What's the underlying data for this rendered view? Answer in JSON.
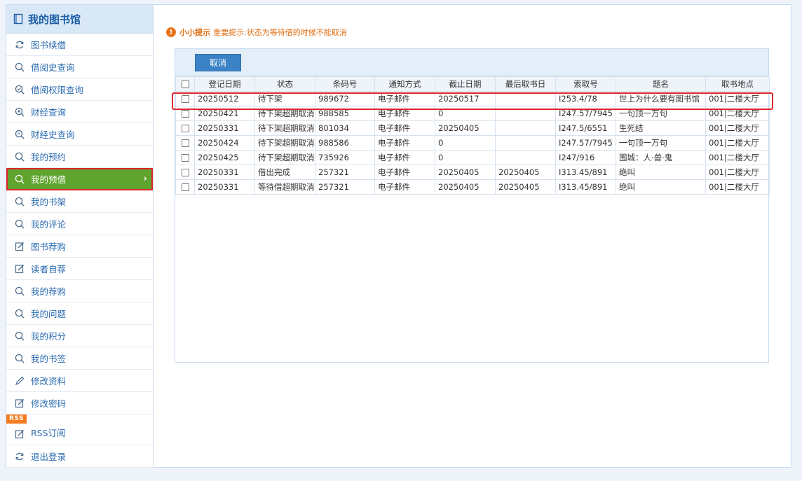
{
  "sidebar": {
    "title": "我的图书馆",
    "items": [
      {
        "label": "图书续借",
        "icon": "refresh-icon",
        "name": "sidebar-item-book-renew"
      },
      {
        "label": "借阅史查询",
        "icon": "search-icon",
        "name": "sidebar-item-borrow-history"
      },
      {
        "label": "借阅权限查询",
        "icon": "check-search-icon",
        "name": "sidebar-item-borrow-permission"
      },
      {
        "label": "财经查询",
        "icon": "finance-search-icon",
        "name": "sidebar-item-finance"
      },
      {
        "label": "财经史查询",
        "icon": "finance-history-icon",
        "name": "sidebar-item-finance-history"
      },
      {
        "label": "我的预约",
        "icon": "search-icon",
        "name": "sidebar-item-my-reservation"
      },
      {
        "label": "我的预借",
        "icon": "search-icon",
        "name": "sidebar-item-my-preborrow",
        "active": true
      },
      {
        "label": "我的书架",
        "icon": "search-icon",
        "name": "sidebar-item-my-bookshelf"
      },
      {
        "label": "我的评论",
        "icon": "search-icon",
        "name": "sidebar-item-my-comments"
      },
      {
        "label": "图书荐购",
        "icon": "edit-icon",
        "name": "sidebar-item-recommend-purchase"
      },
      {
        "label": "读者自荐",
        "icon": "edit-icon",
        "name": "sidebar-item-reader-recommend"
      },
      {
        "label": "我的荐购",
        "icon": "search-icon",
        "name": "sidebar-item-my-recommend"
      },
      {
        "label": "我的问题",
        "icon": "search-icon",
        "name": "sidebar-item-my-questions"
      },
      {
        "label": "我的积分",
        "icon": "search-icon",
        "name": "sidebar-item-my-points"
      },
      {
        "label": "我的书签",
        "icon": "search-icon",
        "name": "sidebar-item-my-bookmarks"
      },
      {
        "label": "修改资料",
        "icon": "pencil-icon",
        "name": "sidebar-item-edit-profile"
      },
      {
        "label": "修改密码",
        "icon": "edit-icon",
        "name": "sidebar-item-change-password"
      },
      {
        "label": "RSS订阅",
        "icon": "edit-icon",
        "name": "sidebar-item-rss",
        "badge": "RSS"
      },
      {
        "label": "退出登录",
        "icon": "refresh-icon",
        "name": "sidebar-item-logout"
      }
    ]
  },
  "tip": {
    "title": "小小提示",
    "text": "重要提示:状态为等待借的时候不能取消"
  },
  "toolbar": {
    "cancel_label": "取消"
  },
  "table": {
    "headers": [
      "登记日期",
      "状态",
      "条码号",
      "通知方式",
      "截止日期",
      "最后取书日",
      "索取号",
      "题名",
      "取书地点"
    ],
    "rows": [
      [
        "20250512",
        "待下架",
        "989672",
        "电子邮件",
        "20250517",
        "",
        "I253.4/78",
        "世上为什么要有图书馆",
        "001|二楼大厅"
      ],
      [
        "20250421",
        "待下架超期取消",
        "988585",
        "电子邮件",
        "0",
        "",
        "I247.57/7945",
        "一句顶一万句",
        "001|二楼大厅"
      ],
      [
        "20250331",
        "待下架超期取消",
        "801034",
        "电子邮件",
        "20250405",
        "",
        "I247.5/6551",
        "生死结",
        "001|二楼大厅"
      ],
      [
        "20250424",
        "待下架超期取消",
        "988586",
        "电子邮件",
        "0",
        "",
        "I247.57/7945",
        "一句顶一万句",
        "001|二楼大厅"
      ],
      [
        "20250425",
        "待下架超期取消",
        "735926",
        "电子邮件",
        "0",
        "",
        "I247/916",
        "围城：人·兽·鬼",
        "001|二楼大厅"
      ],
      [
        "20250331",
        "借出完成",
        "257321",
        "电子邮件",
        "20250405",
        "20250405",
        "I313.45/891",
        "绝叫",
        "001|二楼大厅"
      ],
      [
        "20250331",
        "等待借超期取消",
        "257321",
        "电子邮件",
        "20250405",
        "20250405",
        "I313.45/891",
        "绝叫",
        "001|二楼大厅"
      ]
    ]
  },
  "colors": {
    "active_menu": "#5fa42d",
    "highlight_box": "#e0242b",
    "button": "#3b82c6",
    "tip": "#e06d10"
  }
}
